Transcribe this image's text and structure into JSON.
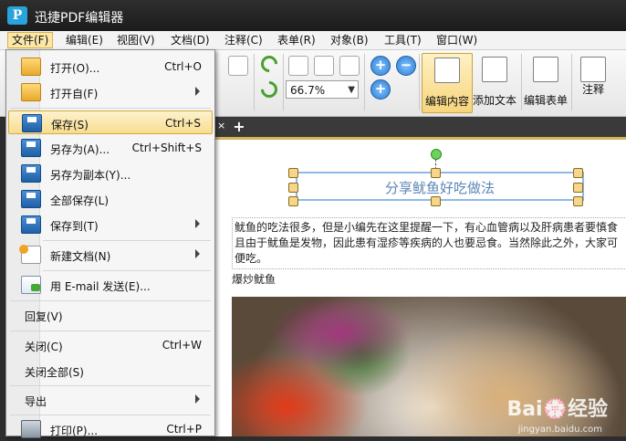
{
  "app": {
    "logo_letter": "P",
    "title": "迅捷PDF编辑器"
  },
  "menubar": {
    "items": [
      "文件(F)",
      "编辑(E)",
      "视图(V)",
      "文档(D)",
      "注释(C)",
      "表单(R)",
      "对象(B)",
      "工具(T)",
      "窗口(W)"
    ],
    "active": "文件(F)"
  },
  "toolbar": {
    "zoom_value": "66.7%",
    "buttons": {
      "edit_content": "编辑内容",
      "add_text": "添加文本",
      "edit_form": "编辑表单",
      "annotate": "注释"
    }
  },
  "tabs": {
    "add_symbol": "+",
    "close_symbol": "×"
  },
  "file_menu": {
    "items": [
      {
        "label": "打开(O)...",
        "shortcut": "Ctrl+O",
        "icon": "folder-icon",
        "submenu": false
      },
      {
        "label": "打开自(F)",
        "shortcut": "",
        "icon": "folder-open-icon",
        "submenu": true
      },
      {
        "label": "保存(S)",
        "shortcut": "Ctrl+S",
        "icon": "save-icon",
        "submenu": false,
        "highlighted": true
      },
      {
        "label": "另存为(A)...",
        "shortcut": "Ctrl+Shift+S",
        "icon": "save-as-icon",
        "submenu": false
      },
      {
        "label": "另存为副本(Y)...",
        "shortcut": "",
        "icon": "save-copy-icon",
        "submenu": false
      },
      {
        "label": "全部保存(L)",
        "shortcut": "",
        "icon": "save-all-icon",
        "submenu": false
      },
      {
        "label": "保存到(T)",
        "shortcut": "",
        "icon": "save-to-icon",
        "submenu": true
      },
      {
        "label": "新建文档(N)",
        "shortcut": "",
        "icon": "new-document-icon",
        "submenu": true
      },
      {
        "label": "用 E-mail 发送(E)...",
        "shortcut": "",
        "icon": "email-icon",
        "submenu": false
      },
      {
        "label": "回复(V)",
        "shortcut": "",
        "icon": "",
        "submenu": false
      },
      {
        "label": "关闭(C)",
        "shortcut": "Ctrl+W",
        "icon": "",
        "submenu": false
      },
      {
        "label": "关闭全部(S)",
        "shortcut": "",
        "icon": "",
        "submenu": false
      },
      {
        "label": "导出",
        "shortcut": "",
        "icon": "",
        "submenu": true
      },
      {
        "label": "打印(P)...",
        "shortcut": "Ctrl+P",
        "icon": "print-icon",
        "submenu": false
      }
    ]
  },
  "document": {
    "title": "分享鱿鱼好吃做法",
    "paragraph": "鱿鱼的吃法很多，但是小编先在这里提醒一下，有心血管病以及肝病患者要慎食\n且由于鱿鱼是发物，因此患有湿疹等疾病的人也要忌食。当然除此之外，大家可\n便吃。",
    "subheading": "爆炒鱿鱼"
  },
  "watermark": {
    "main": "Bai💮经验",
    "sub": "jingyan.baidu.com"
  }
}
